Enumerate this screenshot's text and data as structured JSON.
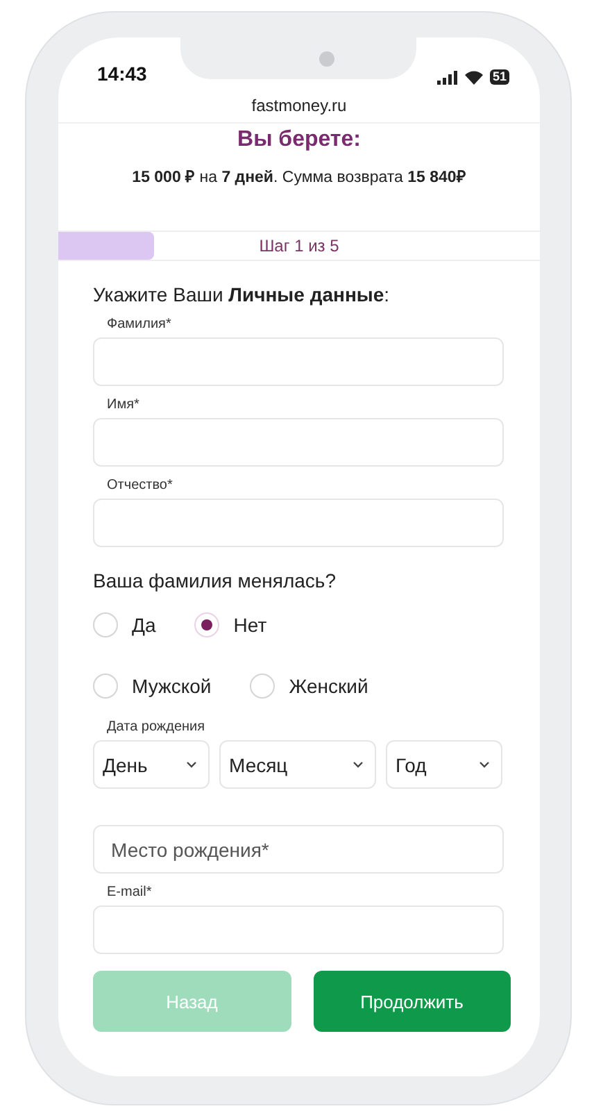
{
  "status_bar": {
    "time": "14:43",
    "battery": "51"
  },
  "address_bar": {
    "url": "fastmoney.ru"
  },
  "offer": {
    "title": "Вы берете:",
    "summary": "**15 000 ₽** на **7 дней**. Сумма возврата **15 840₽**"
  },
  "progress": {
    "label": "Шаг 1 из 5",
    "level": 0.2
  },
  "form": {
    "heading": "Укажите Ваши **Личные данные**:",
    "items": [
      {
        "kind": "field",
        "label": "Фамилия*"
      },
      {
        "kind": "field",
        "label": "Имя*"
      },
      {
        "kind": "field",
        "label": "Отчество*"
      },
      {
        "kind": "question",
        "text": "Ваша фамилия менялась?"
      },
      {
        "kind": "radios",
        "options": [
          {
            "label": "Да",
            "selected": false
          },
          {
            "label": "Нет",
            "selected": true
          }
        ]
      },
      {
        "kind": "radios",
        "options": [
          {
            "label": "Мужской",
            "selected": false
          },
          {
            "label": "Женский",
            "selected": false
          }
        ]
      },
      {
        "kind": "date",
        "label": "Дата рождения",
        "selects": [
          "День",
          "Месяц",
          "Год"
        ]
      },
      {
        "kind": "field",
        "placeholder": "Место рождения*"
      },
      {
        "kind": "field",
        "label": "E-mail*"
      }
    ]
  },
  "buttons": [
    {
      "label": "Назад",
      "disabled": true
    },
    {
      "label": "Продолжить",
      "disabled": false
    }
  ]
}
